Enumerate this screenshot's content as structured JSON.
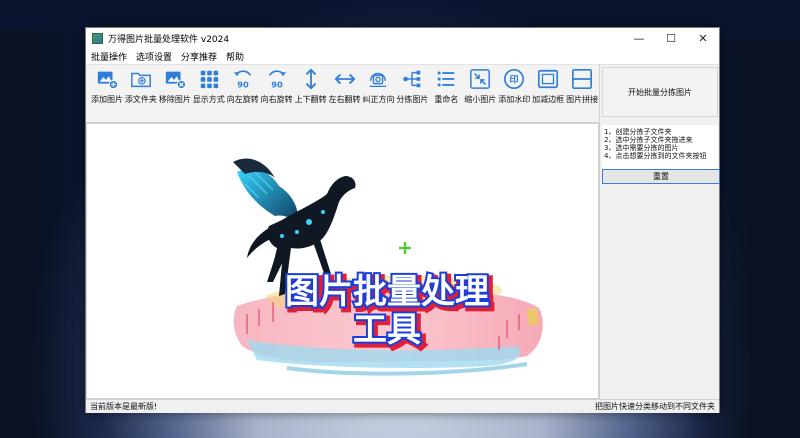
{
  "window": {
    "title": "万得图片批量处理软件 v2024",
    "controls": {
      "minimize": "—",
      "maximize": "☐",
      "close": "✕"
    }
  },
  "menu": [
    "批量操作",
    "选项设置",
    "分享推荐",
    "帮助"
  ],
  "toolbar": [
    {
      "label": "添加图片",
      "icon": "add-image-icon"
    },
    {
      "label": "添文件夹",
      "icon": "add-folder-icon"
    },
    {
      "label": "移除图片",
      "icon": "remove-image-icon"
    },
    {
      "label": "显示方式",
      "icon": "grid-view-icon"
    },
    {
      "label": "向左旋转",
      "icon": "rotate-left-icon",
      "glyph": "90"
    },
    {
      "label": "向右旋转",
      "icon": "rotate-right-icon",
      "glyph": "90"
    },
    {
      "label": "上下翻转",
      "icon": "flip-vertical-icon"
    },
    {
      "label": "左右翻转",
      "icon": "flip-horizontal-icon"
    },
    {
      "label": "纠正方向",
      "icon": "correct-orientation-icon"
    },
    {
      "label": "分拣图片",
      "icon": "sort-images-icon"
    },
    {
      "label": "重命名",
      "icon": "rename-icon"
    },
    {
      "label": "缩小图片",
      "icon": "shrink-image-icon"
    },
    {
      "label": "添加水印",
      "icon": "watermark-icon",
      "glyph": "印"
    },
    {
      "label": "加减边框",
      "icon": "border-icon"
    },
    {
      "label": "图片拼接",
      "icon": "stitch-images-icon"
    }
  ],
  "canvas": {
    "banner_line1": "图片批量处理",
    "banner_line2": "工具"
  },
  "sidebar": {
    "split_button": "开始批量分拣图片",
    "instructions": [
      "1、创建分拣子文件夹",
      "2、选中分拣子文件夹拖进来",
      "3、选中需要分拣的图片",
      "4、点击想要分拣到的文件夹按钮"
    ],
    "reset_button": "重置"
  },
  "status": {
    "left": "当前版本是最新版!",
    "right": "把图片快速分类移动到不同文件夹"
  },
  "colors": {
    "accent": "#1f6fd1",
    "banner_text": "#ffffff",
    "banner_outline": "#1a3fd9",
    "banner_shadow": "#e0203a"
  }
}
